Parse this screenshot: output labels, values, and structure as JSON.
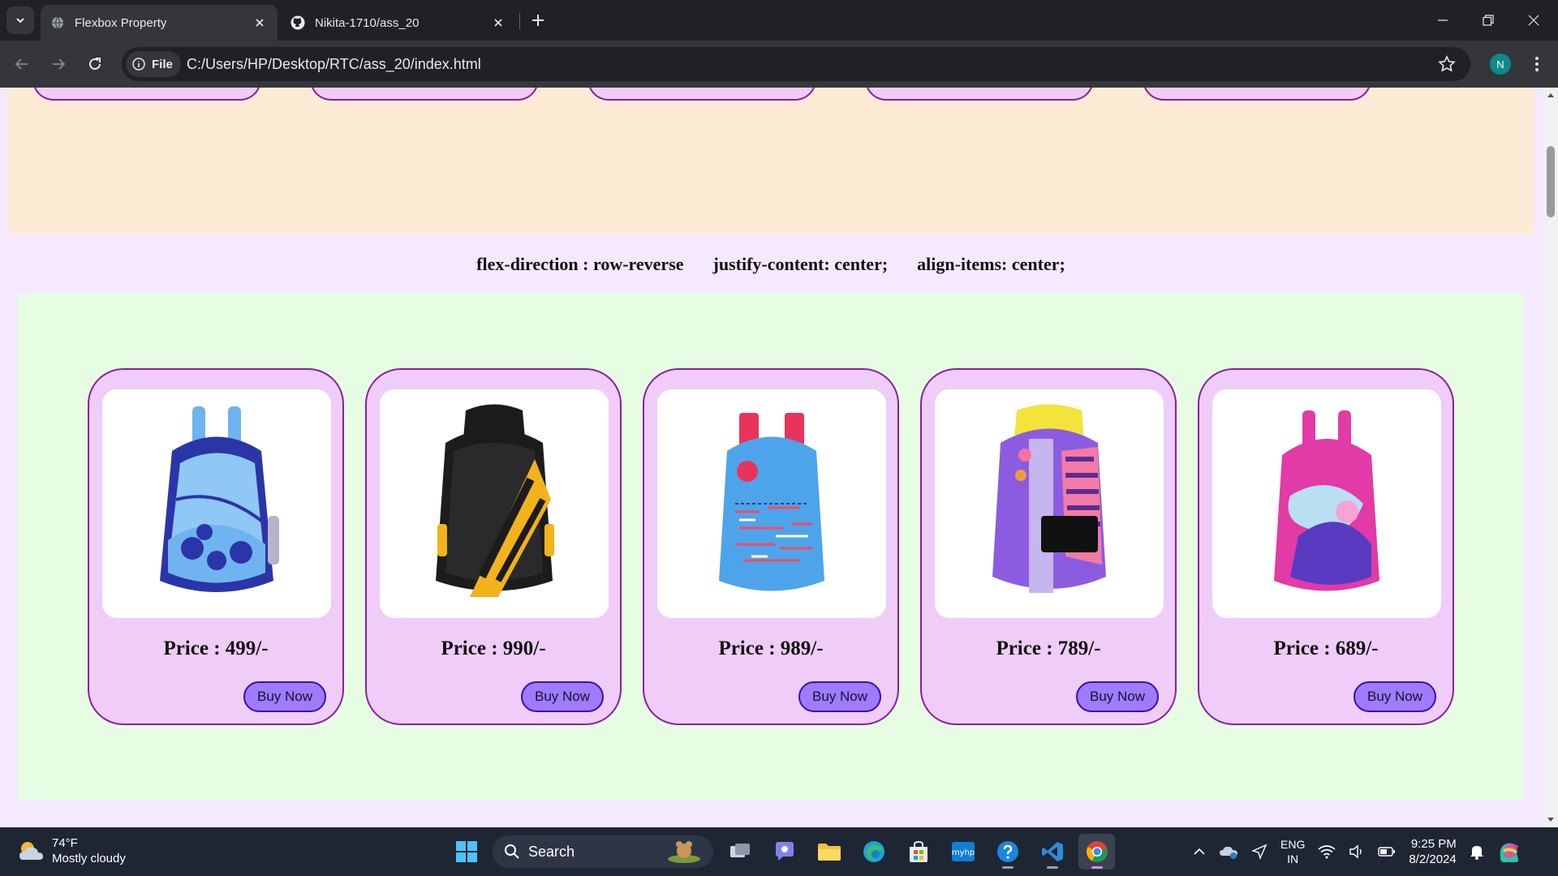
{
  "browser": {
    "tabs": [
      {
        "title": "Flexbox Property",
        "active": true
      },
      {
        "title": "Nikita-1710/ass_20",
        "active": false
      }
    ],
    "site_chip": "File",
    "url": "C:/Users/HP/Desktop/RTC/ass_20/index.html",
    "profile_initial": "N"
  },
  "page": {
    "section_labels": [
      "flex-direction : row-reverse",
      "justify-content: center;",
      "align-items: center;"
    ],
    "cards": [
      {
        "price": "Price : 499/-",
        "button": "Buy Now",
        "bag": "blue-backpack",
        "colors": [
          "#6fb3ef",
          "#2a35a8"
        ]
      },
      {
        "price": "Price : 990/-",
        "button": "Buy Now",
        "bag": "black-skybags-backpack",
        "colors": [
          "#1c1c1e",
          "#f2b21b"
        ]
      },
      {
        "price": "Price : 989/-",
        "button": "Buy Now",
        "bag": "sky-blue-backpack",
        "colors": [
          "#4ea4ea",
          "#e8345a"
        ]
      },
      {
        "price": "Price : 789/-",
        "button": "Buy Now",
        "bag": "purple-yellow-backpack",
        "colors": [
          "#8b5ce0",
          "#f3e33a"
        ]
      },
      {
        "price": "Price : 689/-",
        "button": "Buy Now",
        "bag": "pink-backpack",
        "colors": [
          "#e23aa6",
          "#5a3ac0"
        ]
      }
    ]
  },
  "taskbar": {
    "weather_temp": "74°F",
    "weather_desc": "Mostly cloudy",
    "search_label": "Search",
    "lang_top": "ENG",
    "lang_bottom": "IN",
    "time": "9:25 PM",
    "date": "8/2/2024"
  }
}
